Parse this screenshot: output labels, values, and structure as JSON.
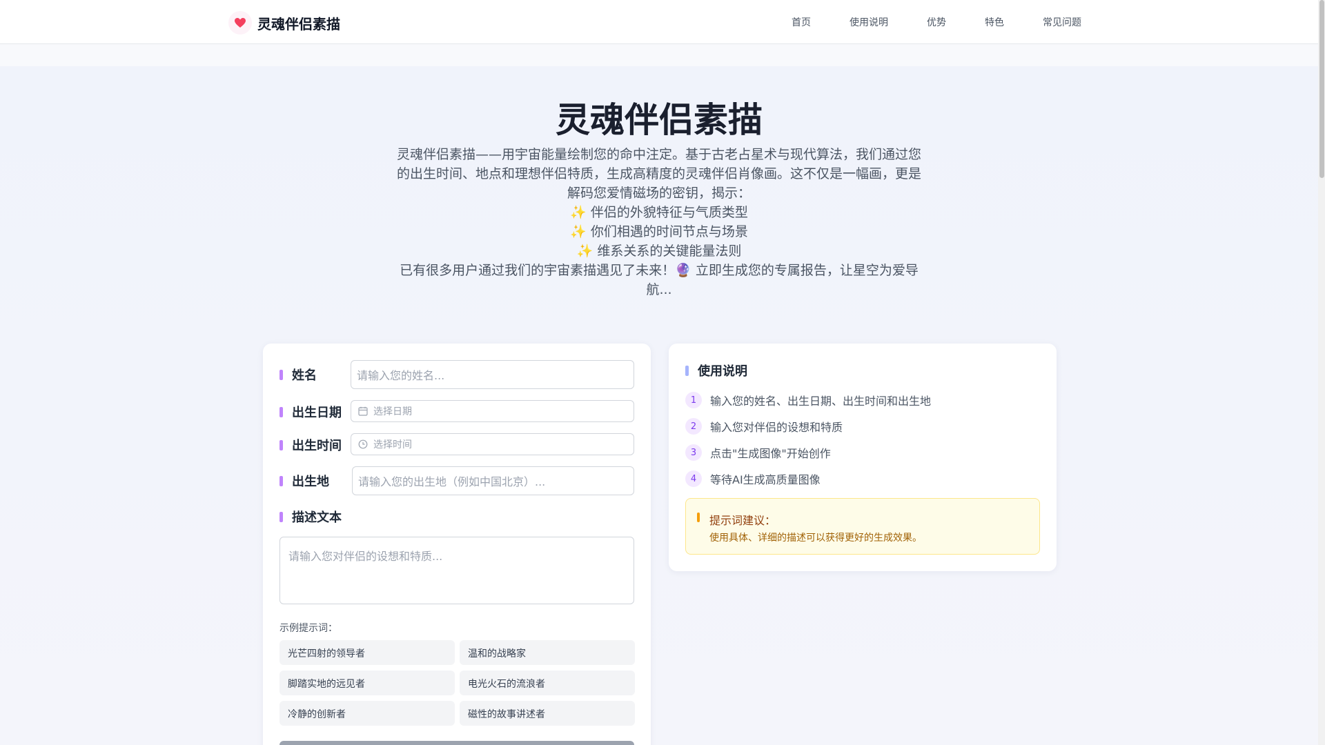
{
  "header": {
    "brand_name": "灵魂伴侣素描",
    "nav": [
      "首页",
      "使用说明",
      "优势",
      "特色",
      "常见问题"
    ]
  },
  "hero": {
    "title": "灵魂伴侣素描",
    "description": "灵魂伴侣素描——用宇宙能量绘制您的命中注定。基于古老占星术与现代算法，我们通过您的出生时间、地点和理想伴侣特质，生成高精度的灵魂伴侣肖像画。这不仅是一幅画，更是解码您爱情磁场的密钥，揭示：\n✨ 伴侣的外貌特征与气质类型\n✨ 你们相遇的时间节点与场景\n✨ 维系关系的关键能量法则\n已有很多用户通过我们的宇宙素描遇见了未来！🔮 立即生成您的专属报告，让星空为爱导航..."
  },
  "form": {
    "name_label": "姓名",
    "name_placeholder": "请输入您的姓名...",
    "birth_date_label": "出生日期",
    "birth_date_placeholder": "选择日期",
    "birth_time_label": "出生时间",
    "birth_time_placeholder": "选择时间",
    "birth_place_label": "出生地",
    "birth_place_placeholder": "请输入您的出生地（例如中国北京）...",
    "description_label": "描述文本",
    "description_placeholder": "请输入您对伴侣的设想和特质...",
    "examples_title": "示例提示词：",
    "examples": [
      "光芒四射的领导者",
      "温和的战略家",
      "脚踏实地的远见者",
      "电光火石的流浪者",
      "冷静的创新者",
      "磁性的故事讲述者"
    ]
  },
  "help": {
    "title": "使用说明",
    "steps": [
      {
        "num": "1",
        "text": "输入您的姓名、出生日期、出生时间和出生地"
      },
      {
        "num": "2",
        "text": "输入您对伴侣的设想和特质"
      },
      {
        "num": "3",
        "text": "点击\"生成图像\"开始创作"
      },
      {
        "num": "4",
        "text": "等待AI生成高质量图像"
      }
    ],
    "tip_title": "提示词建议：",
    "tip_text": "使用具体、详细的描述可以获得更好的生成效果。"
  },
  "colors": {
    "accent_purple": "#c084fc",
    "step_badge": "#f3e8ff",
    "tip_background": "#fefce8",
    "heart": "#f43f5e"
  },
  "icons": {
    "logo": "heart-icon",
    "date": "calendar-icon",
    "time": "clock-icon"
  }
}
